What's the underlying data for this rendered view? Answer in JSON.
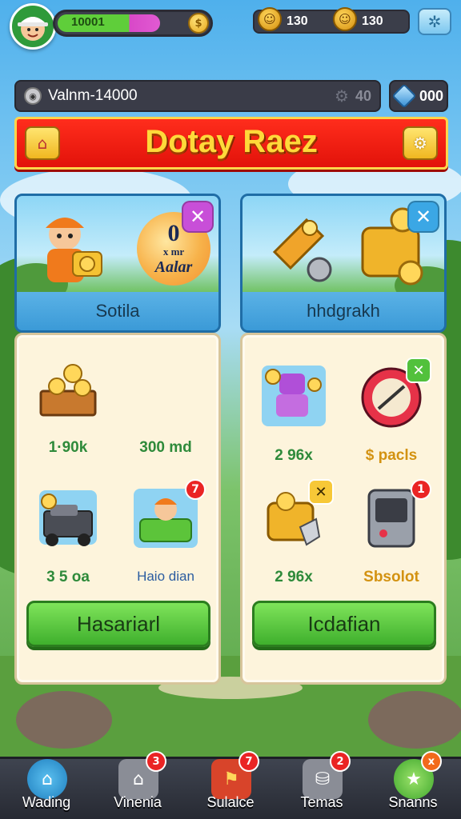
{
  "hud": {
    "xp_value": "10001",
    "xp_fraction": 0.66,
    "resources": [
      {
        "icon": "gold-figure-icon",
        "value": "130"
      },
      {
        "icon": "gold-figure-icon",
        "value": "130"
      }
    ],
    "settings_icon": "puzzle-gear-icon"
  },
  "search": {
    "text": "Valnm-14000",
    "count": "40",
    "gems": "000"
  },
  "banner": {
    "title": "Dotay Raez"
  },
  "cards": {
    "left_header": {
      "label": "Sotila",
      "bubble_big": "0",
      "bubble_small": "x mr",
      "bubble_name": "Aalar"
    },
    "right_header": {
      "label": "hhdgrakh"
    },
    "left_items": [
      {
        "value": "1·90k"
      },
      {
        "value": "300 md"
      },
      {
        "value": "3 5 oa"
      },
      {
        "value": "Haio dian",
        "badge": "7"
      }
    ],
    "left_button": "Hasariarl",
    "right_items": [
      {
        "value": "2 96x"
      },
      {
        "value": "$ pacls"
      },
      {
        "value": "2 96x"
      },
      {
        "value": "Sbsolot",
        "badge": "1"
      }
    ],
    "right_button": "Icdafian",
    "close_glyph": "✕"
  },
  "nav": [
    {
      "label": "Wading",
      "badge": ""
    },
    {
      "label": "Vinenia",
      "badge": "3"
    },
    {
      "label": "Sulalce",
      "badge": "7"
    },
    {
      "label": "Temas",
      "badge": "2"
    },
    {
      "label": "Snanns",
      "badge": "x"
    }
  ],
  "colors": {
    "accent_green": "#3fb02d",
    "banner_red": "#e2120a",
    "banner_text": "#ffd93a",
    "card_blue": "#3b9ad7",
    "badge_red": "#ea2424"
  }
}
